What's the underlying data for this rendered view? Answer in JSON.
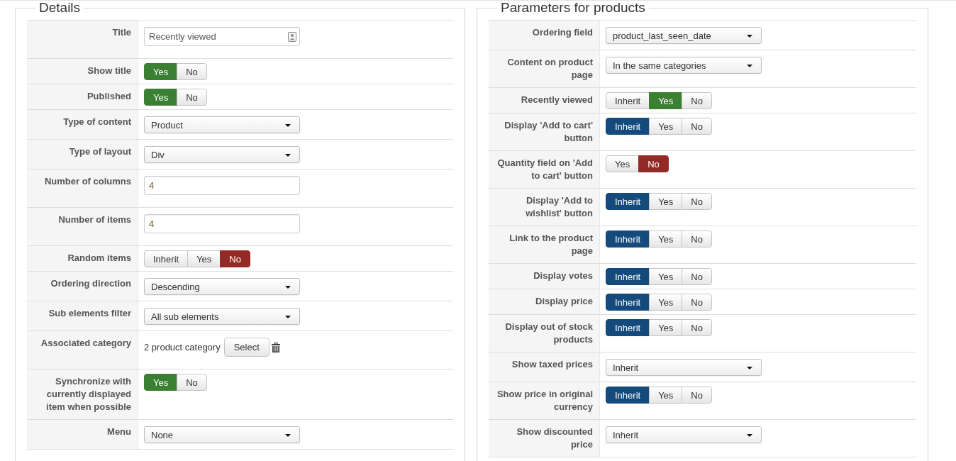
{
  "fieldsets": [
    {
      "legend": "Details",
      "rows": [
        {
          "label": "Title",
          "kind": "iconinput",
          "value": "Recently viewed"
        },
        {
          "label": "Show title",
          "kind": "toggle",
          "options": [
            {
              "label": "Yes",
              "selected": true,
              "color": "#3b7f33"
            },
            {
              "label": "No",
              "selected": false
            }
          ]
        },
        {
          "label": "Published",
          "kind": "toggle",
          "options": [
            {
              "label": "Yes",
              "selected": true,
              "color": "#3b7f33"
            },
            {
              "label": "No",
              "selected": false
            }
          ]
        },
        {
          "label": "Type of content",
          "kind": "select",
          "value": "Product"
        },
        {
          "label": "Type of layout",
          "kind": "select",
          "value": "Div"
        },
        {
          "label": "Number of columns",
          "kind": "input",
          "value": "4"
        },
        {
          "label": "Number of items",
          "kind": "input",
          "value": "4"
        },
        {
          "label": "Random items",
          "kind": "toggle",
          "options": [
            {
              "label": "Inherit",
              "selected": false
            },
            {
              "label": "Yes",
              "selected": false
            },
            {
              "label": "No",
              "selected": true,
              "color": "#942a25"
            }
          ]
        },
        {
          "label": "Ordering direction",
          "kind": "select",
          "value": "Descending"
        },
        {
          "label": "Sub elements filter",
          "kind": "select",
          "value": "All sub elements"
        },
        {
          "label": "Associated category",
          "kind": "picker",
          "value": "2 product category",
          "button": "Select"
        },
        {
          "label": "Synchronize with currently displayed item when possible",
          "kind": "toggle",
          "options": [
            {
              "label": "Yes",
              "selected": true,
              "color": "#3b7f33"
            },
            {
              "label": "No",
              "selected": false
            }
          ]
        },
        {
          "label": "Menu",
          "kind": "select",
          "value": "None"
        }
      ]
    },
    {
      "legend": "Parameters for products",
      "rows": [
        {
          "label": "Ordering field",
          "kind": "select",
          "value": "product_last_seen_date"
        },
        {
          "label": "Content on product page",
          "kind": "select",
          "value": "In the same categories"
        },
        {
          "label": "Recently viewed",
          "kind": "toggle",
          "options": [
            {
              "label": "Inherit",
              "selected": false
            },
            {
              "label": "Yes",
              "selected": true,
              "color": "#3b7f33"
            },
            {
              "label": "No",
              "selected": false
            }
          ]
        },
        {
          "label": "Display 'Add to cart' button",
          "kind": "toggle",
          "options": [
            {
              "label": "Inherit",
              "selected": true,
              "color": "#154a7d"
            },
            {
              "label": "Yes",
              "selected": false
            },
            {
              "label": "No",
              "selected": false
            }
          ]
        },
        {
          "label": "Quantity field on 'Add to cart' button",
          "kind": "toggle",
          "options": [
            {
              "label": "Yes",
              "selected": false
            },
            {
              "label": "No",
              "selected": true,
              "color": "#942a25"
            }
          ]
        },
        {
          "label": "Display 'Add to wishlist' button",
          "kind": "toggle",
          "options": [
            {
              "label": "Inherit",
              "selected": true,
              "color": "#154a7d"
            },
            {
              "label": "Yes",
              "selected": false
            },
            {
              "label": "No",
              "selected": false
            }
          ]
        },
        {
          "label": "Link to the product page",
          "kind": "toggle",
          "options": [
            {
              "label": "Inherit",
              "selected": true,
              "color": "#154a7d"
            },
            {
              "label": "Yes",
              "selected": false
            },
            {
              "label": "No",
              "selected": false
            }
          ]
        },
        {
          "label": "Display votes",
          "kind": "toggle",
          "options": [
            {
              "label": "Inherit",
              "selected": true,
              "color": "#154a7d"
            },
            {
              "label": "Yes",
              "selected": false
            },
            {
              "label": "No",
              "selected": false
            }
          ]
        },
        {
          "label": "Display price",
          "kind": "toggle",
          "options": [
            {
              "label": "Inherit",
              "selected": true,
              "color": "#154a7d"
            },
            {
              "label": "Yes",
              "selected": false
            },
            {
              "label": "No",
              "selected": false
            }
          ]
        },
        {
          "label": "Display out of stock products",
          "kind": "toggle",
          "options": [
            {
              "label": "Inherit",
              "selected": true,
              "color": "#154a7d"
            },
            {
              "label": "Yes",
              "selected": false
            },
            {
              "label": "No",
              "selected": false
            }
          ]
        },
        {
          "label": "Show taxed prices",
          "kind": "select",
          "value": "Inherit"
        },
        {
          "label": "Show price in original currency",
          "kind": "toggle",
          "options": [
            {
              "label": "Inherit",
              "selected": true,
              "color": "#154a7d"
            },
            {
              "label": "Yes",
              "selected": false
            },
            {
              "label": "No",
              "selected": false
            }
          ]
        },
        {
          "label": "Show discounted price",
          "kind": "select",
          "value": "Inherit"
        }
      ]
    }
  ]
}
